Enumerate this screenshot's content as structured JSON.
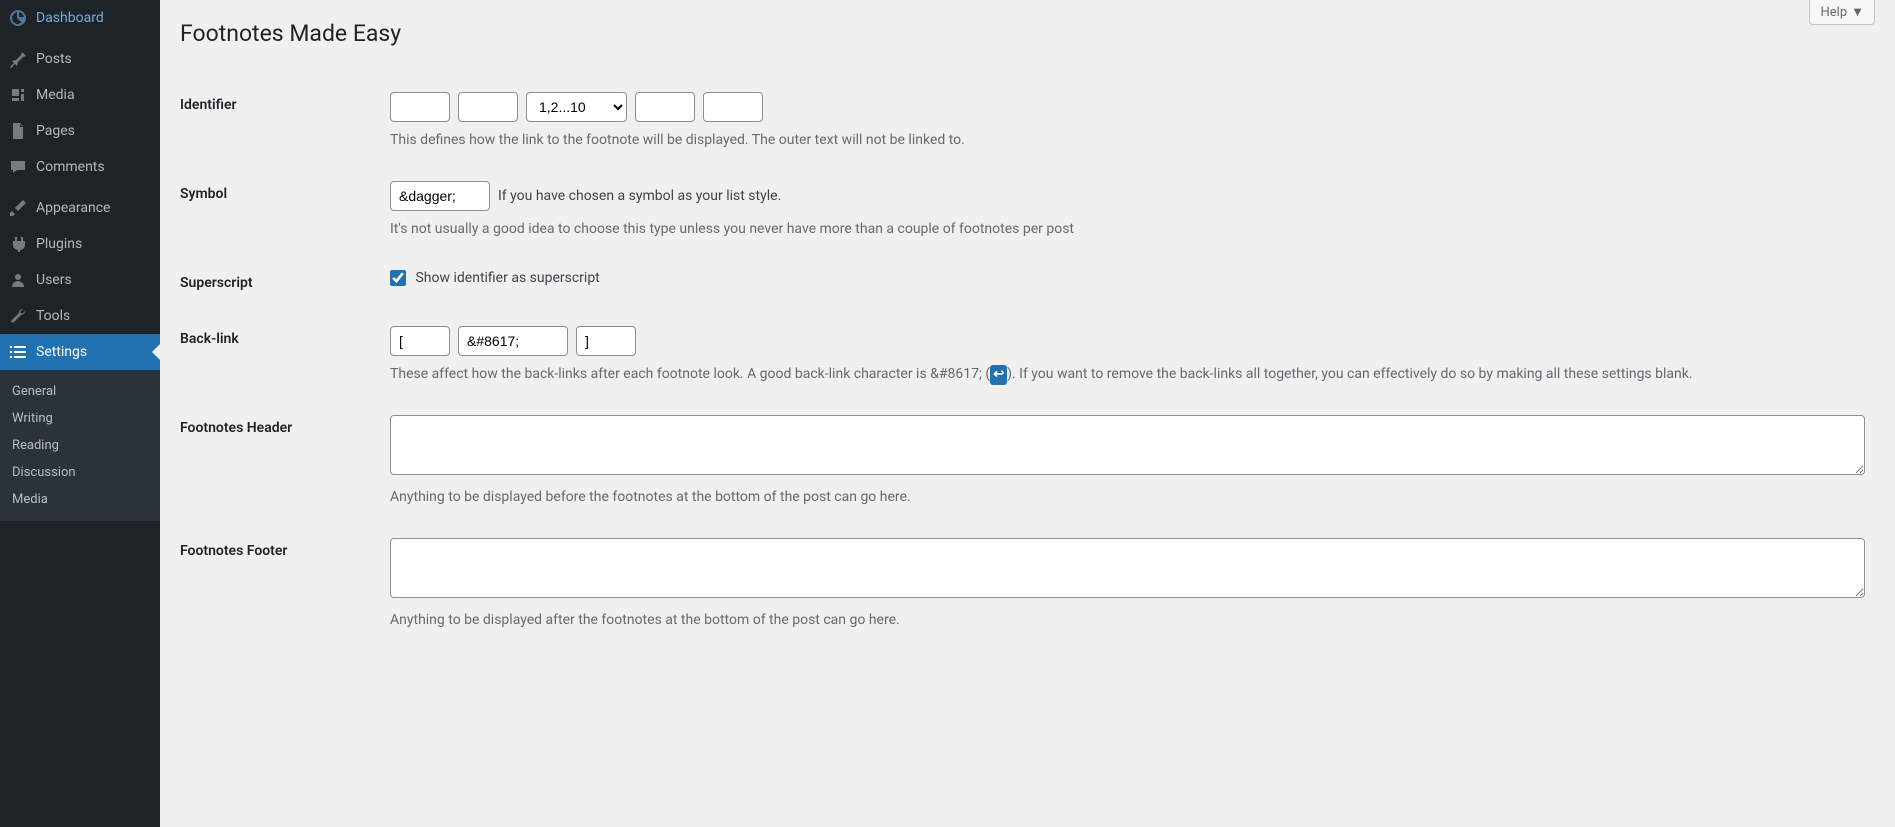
{
  "header": {
    "help_label": "Help"
  },
  "page": {
    "title": "Footnotes Made Easy"
  },
  "sidebar": {
    "items": [
      {
        "label": "Dashboard"
      },
      {
        "label": "Posts"
      },
      {
        "label": "Media"
      },
      {
        "label": "Pages"
      },
      {
        "label": "Comments"
      },
      {
        "label": "Appearance"
      },
      {
        "label": "Plugins"
      },
      {
        "label": "Users"
      },
      {
        "label": "Tools"
      },
      {
        "label": "Settings"
      }
    ],
    "submenu": [
      {
        "label": "General"
      },
      {
        "label": "Writing"
      },
      {
        "label": "Reading"
      },
      {
        "label": "Discussion"
      },
      {
        "label": "Media"
      }
    ]
  },
  "form": {
    "identifier": {
      "label": "Identifier",
      "pre1": "",
      "pre2": "",
      "select": "1,2...10",
      "post1": "",
      "post2": "",
      "desc": "This defines how the link to the footnote will be displayed. The outer text will not be linked to."
    },
    "symbol": {
      "label": "Symbol",
      "value": "&dagger;",
      "inline": "If you have chosen a symbol as your list style.",
      "desc": "It's not usually a good idea to choose this type unless you never have more than a couple of footnotes per post"
    },
    "superscript": {
      "label": "Superscript",
      "checked": true,
      "text": "Show identifier as superscript"
    },
    "backlink": {
      "label": "Back-link",
      "pre": "[",
      "mid": "&#8617;",
      "post": "]",
      "desc1": "These affect how the back-links after each footnote look. A good back-link character is &#8617; (",
      "desc2": "). If you want to remove the back-links all together, you can effectively do so by making all these settings blank."
    },
    "header_field": {
      "label": "Footnotes Header",
      "value": "",
      "desc": "Anything to be displayed before the footnotes at the bottom of the post can go here."
    },
    "footer_field": {
      "label": "Footnotes Footer",
      "value": "",
      "desc": "Anything to be displayed after the footnotes at the bottom of the post can go here."
    }
  }
}
